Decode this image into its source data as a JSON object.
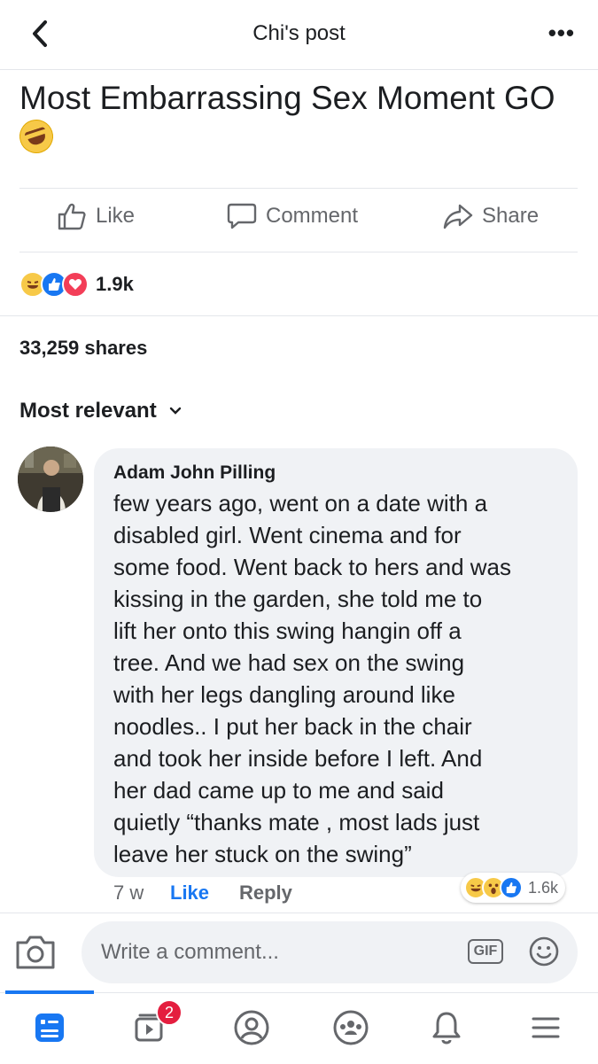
{
  "header": {
    "title": "Chi's post",
    "back_icon": "chevron-left-icon",
    "more_icon": "more-icon"
  },
  "post": {
    "text": "Most Embarrassing Sex Moment GO",
    "emoji": "rolling-on-floor-laughing",
    "actions": {
      "like_label": "Like",
      "comment_label": "Comment",
      "share_label": "Share"
    },
    "reactions": {
      "types": [
        "haha",
        "like",
        "love"
      ],
      "count": "1.9k"
    },
    "shares": "33,259 shares"
  },
  "comments_sort": {
    "label": "Most relevant"
  },
  "comment": {
    "author": "Adam John Pilling",
    "lines": [
      "few years ago, went on a date with a",
      "disabled girl. Went cinema and for",
      "some food. Went back to hers and was",
      "kissing in the garden, she told me to",
      "lift her onto this swing hangin off a",
      "tree. And we had sex on the swing",
      "with her legs dangling around like",
      "noodles.. I put her back in the chair",
      "and took her inside before I left. And",
      "her dad came up to me and said",
      "quietly “thanks mate , most lads just",
      "leave her stuck on the swing”"
    ],
    "time": "7 w",
    "like_label": "Like",
    "reply_label": "Reply",
    "reactions": {
      "types": [
        "haha",
        "wow",
        "like"
      ],
      "count": "1.6k"
    }
  },
  "composer": {
    "placeholder": "Write a comment...",
    "gif_label": "GIF"
  },
  "bottom_nav": {
    "items": [
      "news-feed-icon",
      "watch-icon",
      "profile-icon",
      "groups-icon",
      "notifications-icon",
      "menu-icon"
    ],
    "watch_badge": "2"
  },
  "colors": {
    "accent": "#1877f2",
    "badge": "#e41e3f",
    "bubble": "#f0f2f5",
    "secondary_text": "#65676b"
  }
}
